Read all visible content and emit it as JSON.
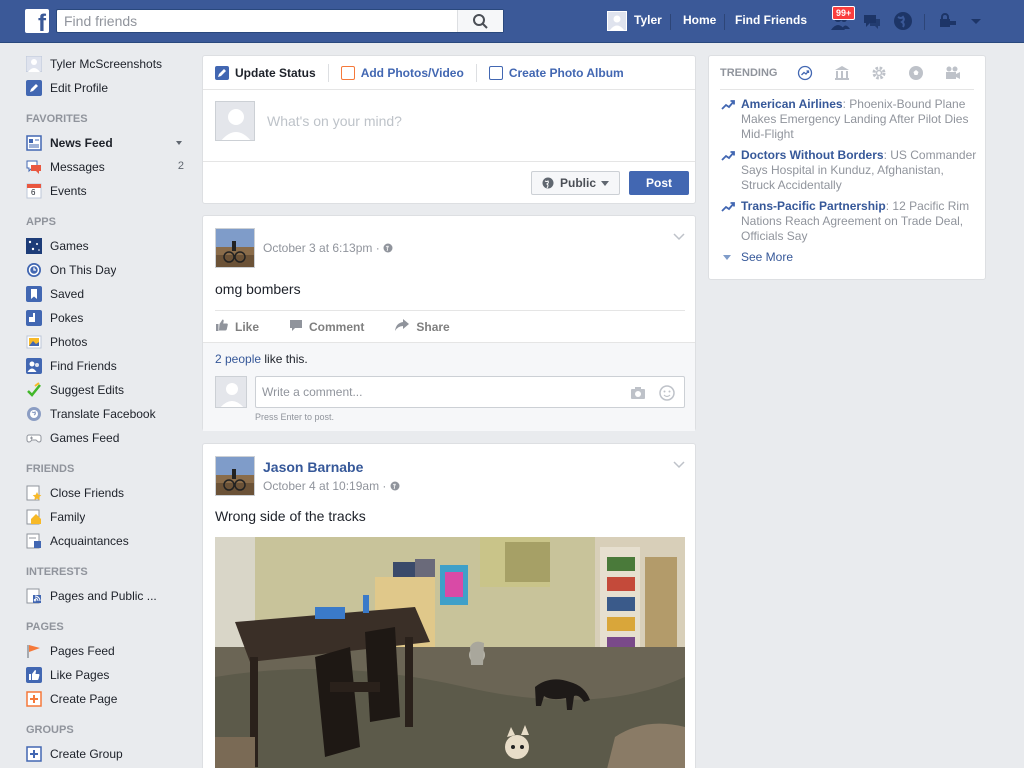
{
  "topbar": {
    "logo_letter": "f",
    "search_placeholder": "Find friends",
    "user_name": "Tyler",
    "home_label": "Home",
    "find_friends_label": "Find Friends",
    "notification_badge": "99+",
    "brand_color": "#3b5998"
  },
  "leftnav": {
    "profile": [
      {
        "label": "Tyler McScreenshots",
        "icon": "profile-picture-icon"
      },
      {
        "label": "Edit Profile",
        "icon": "pencil-icon"
      }
    ],
    "favorites_heading": "FAVORITES",
    "favorites": [
      {
        "label": "News Feed",
        "icon": "news-feed-icon",
        "count": ""
      },
      {
        "label": "Messages",
        "icon": "messages-icon",
        "count": "2"
      },
      {
        "label": "Events",
        "icon": "calendar-icon",
        "count": "",
        "icon_text": "6"
      }
    ],
    "apps_heading": "APPS",
    "apps": [
      {
        "label": "Games",
        "icon": "games-icon"
      },
      {
        "label": "On This Day",
        "icon": "on-this-day-icon"
      },
      {
        "label": "Saved",
        "icon": "bookmark-icon"
      },
      {
        "label": "Pokes",
        "icon": "poke-icon"
      },
      {
        "label": "Photos",
        "icon": "photos-icon"
      },
      {
        "label": "Find Friends",
        "icon": "find-friends-icon"
      },
      {
        "label": "Suggest Edits",
        "icon": "checkmark-pencil-icon"
      },
      {
        "label": "Translate Facebook",
        "icon": "globe-icon"
      },
      {
        "label": "Games Feed",
        "icon": "controller-icon"
      }
    ],
    "friends_heading": "FRIENDS",
    "friends": [
      {
        "label": "Close Friends",
        "icon": "star-list-icon"
      },
      {
        "label": "Family",
        "icon": "house-icon"
      },
      {
        "label": "Acquaintances",
        "icon": "list-icon"
      }
    ],
    "interests_heading": "INTERESTS",
    "interests": [
      {
        "label": "Pages and Public ...",
        "icon": "rss-icon"
      }
    ],
    "pages_heading": "PAGES",
    "pages": [
      {
        "label": "Pages Feed",
        "icon": "flag-icon"
      },
      {
        "label": "Like Pages",
        "icon": "thumbs-up-icon"
      },
      {
        "label": "Create Page",
        "icon": "plus-square-icon"
      }
    ],
    "groups_heading": "GROUPS",
    "groups": [
      {
        "label": "Create Group",
        "icon": "plus-square-icon"
      }
    ]
  },
  "composer": {
    "tabs": [
      "Update Status",
      "Add Photos/Video",
      "Create Photo Album"
    ],
    "placeholder": "What's on your mind?",
    "privacy_label": "Public",
    "post_label": "Post"
  },
  "posts": [
    {
      "author": "",
      "timestamp": "October 3 at 6:13pm · ",
      "text": "omg bombers",
      "actions": [
        "Like",
        "Comment",
        "Share"
      ],
      "likes_count_link": "2 people",
      "likes_suffix": " like this.",
      "comment_placeholder": "Write a comment...",
      "comment_hint": "Press Enter to post."
    },
    {
      "author": "Jason Barnabe",
      "timestamp": "October 4 at 10:19am · ",
      "text": "Wrong side of the tracks"
    }
  ],
  "trending": {
    "title": "TRENDING",
    "tabs": [
      "trending-arrow-icon",
      "politics-building-icon",
      "science-gear-icon",
      "sports-ball-icon",
      "entertainment-camera-icon"
    ],
    "items": [
      {
        "topic": "American Airlines",
        "headline": ": Phoenix-Bound Plane Makes Emergency Landing After Pilot Dies Mid-Flight"
      },
      {
        "topic": "Doctors Without Borders",
        "headline": ": US Commander Says Hospital in Kunduz, Afghanistan, Struck Accidentally"
      },
      {
        "topic": "Trans-Pacific Partnership",
        "headline": ": 12 Pacific Rim Nations Reach Agreement on Trade Deal, Officials Say"
      }
    ],
    "see_more": "See More"
  }
}
